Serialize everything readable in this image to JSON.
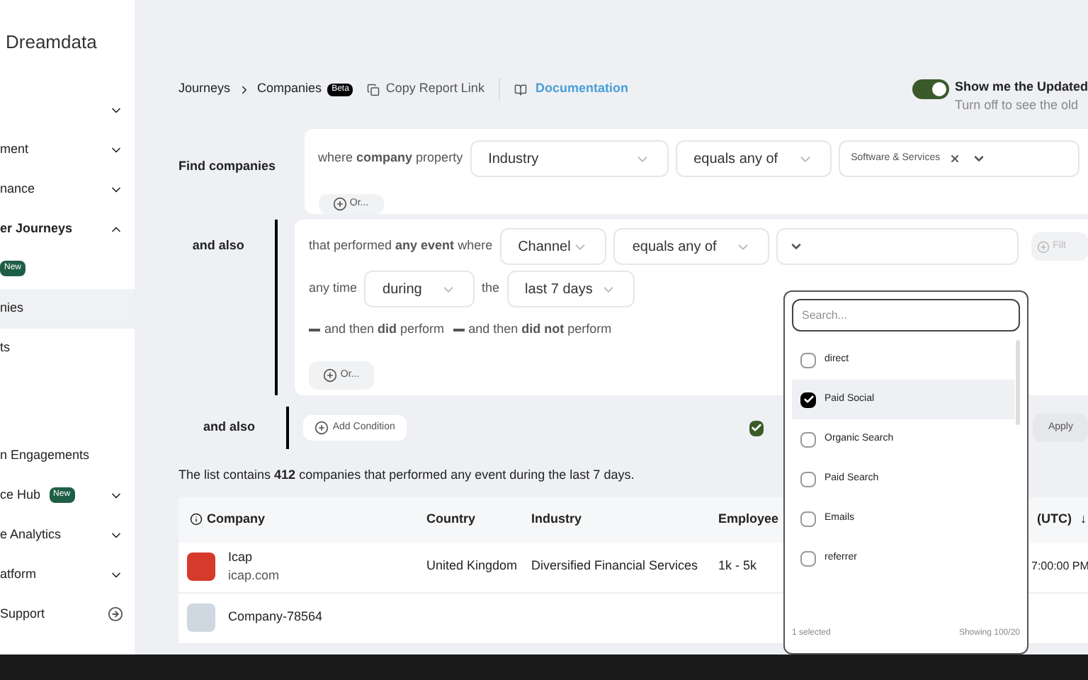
{
  "sidebar": {
    "brand": "Dreamdata",
    "items": [
      {
        "kind": "chevron",
        "expanded": false,
        "selected": false
      },
      {
        "label": "ment",
        "kind": "chevron",
        "expanded": false,
        "selected": false
      },
      {
        "label": "nance",
        "kind": "chevron",
        "expanded": false,
        "selected": false
      },
      {
        "label": "er Journeys",
        "kind": "chevron",
        "expanded": true,
        "selected": false
      },
      {
        "kind": "badge",
        "badge": "New",
        "selected": false
      },
      {
        "label": "nies",
        "kind": "plain",
        "selected": true
      },
      {
        "label": "ts",
        "kind": "plain",
        "selected": false
      },
      {
        "kind": "spacer",
        "selected": false
      },
      {
        "label": "n Engagements",
        "kind": "plain",
        "selected": false
      },
      {
        "label": "ce Hub",
        "kind": "chevron",
        "badge": "New",
        "expanded": false,
        "selected": false
      },
      {
        "label": "e Analytics",
        "kind": "chevron",
        "expanded": false,
        "selected": false
      },
      {
        "label": "atform",
        "kind": "chevron",
        "expanded": false,
        "selected": false
      },
      {
        "label": "Support",
        "kind": "exit",
        "selected": false
      }
    ]
  },
  "breadcrumb": [
    "Journeys",
    "Companies"
  ],
  "beta": "Beta",
  "copy_link": "Copy Report Link",
  "documentation": "Documentation",
  "toggle": {
    "on": true,
    "title": "Show me the Updated",
    "subtitle": "Turn off to see the old"
  },
  "find": {
    "label": "Find companies",
    "text": "where **company** property",
    "property": "Industry",
    "operator": "equals any of",
    "tag": "Software & Services",
    "or": "Or..."
  },
  "event": {
    "label": "and also",
    "text": "that performed **any event** where",
    "property": "Channel",
    "operator": "equals any of",
    "filter": "Filt",
    "time_text": "any time",
    "time_op": "during",
    "the": "the",
    "time_value": "last 7 days",
    "then_did": "and then **did** perform",
    "then_not": "and then **did not** perform",
    "or": "Or..."
  },
  "add": {
    "label": "and also",
    "button": "Add Condition",
    "checked": true,
    "apply": "Apply"
  },
  "summary": "The list contains **412** companies that performed any event during the last 7 days.",
  "table": {
    "columns": [
      "Company",
      "Country",
      "Industry",
      "Employee",
      "(UTC)"
    ],
    "sort": "↓",
    "rows": [
      {
        "name": "Icap",
        "domain": "icap.com",
        "country": "United Kingdom",
        "industry": "Diversified Financial Services",
        "employees": "1k - 5k",
        "time": "7:00:00 PM"
      },
      {
        "name": "Company-78564"
      }
    ]
  },
  "dropdown": {
    "placeholder": "Search...",
    "options": [
      {
        "label": "direct",
        "checked": false,
        "selected": false
      },
      {
        "label": "Paid Social",
        "checked": true,
        "selected": true
      },
      {
        "label": "Organic Search",
        "checked": false,
        "selected": false
      },
      {
        "label": "Paid Search",
        "checked": false,
        "selected": false
      },
      {
        "label": "Emails",
        "checked": false,
        "selected": false
      },
      {
        "label": "referrer",
        "checked": false,
        "selected": false
      }
    ],
    "selected_count": "1 selected",
    "showing": "Showing 100/20"
  }
}
